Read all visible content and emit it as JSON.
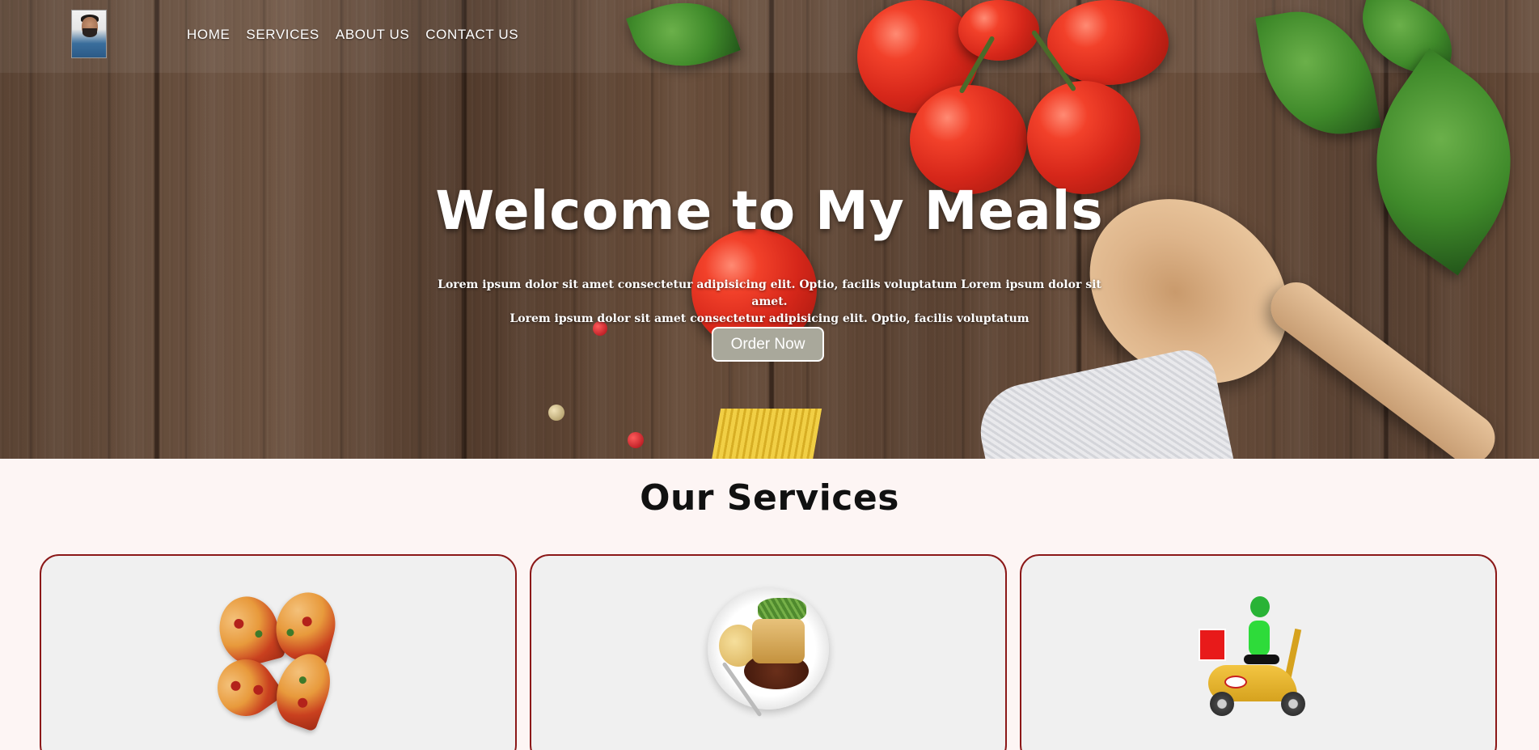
{
  "nav": {
    "logo_alt": "profile photo",
    "links": [
      "HOME",
      "SERVICES",
      "ABOUT US",
      "CONTACT US"
    ]
  },
  "hero": {
    "title": "Welcome to My Meals",
    "text_line1": "Lorem ipsum dolor sit amet consectetur adipisicing elit. Optio, facilis voluptatum Lorem ipsum dolor sit amet.",
    "text_line2": "Lorem ipsum dolor sit amet consectetur adipisicing elit. Optio, facilis voluptatum",
    "button_label": "Order Now"
  },
  "services": {
    "title": "Our Services",
    "cards": [
      {
        "icon": "pizza-image"
      },
      {
        "icon": "plated-meal-image"
      },
      {
        "icon": "delivery-scooter-image"
      }
    ]
  },
  "colors": {
    "card_border": "#8b1818",
    "card_bg": "#f0f0f0",
    "page_bg": "#fdf5f4",
    "button_bg": "#a9a89b"
  }
}
